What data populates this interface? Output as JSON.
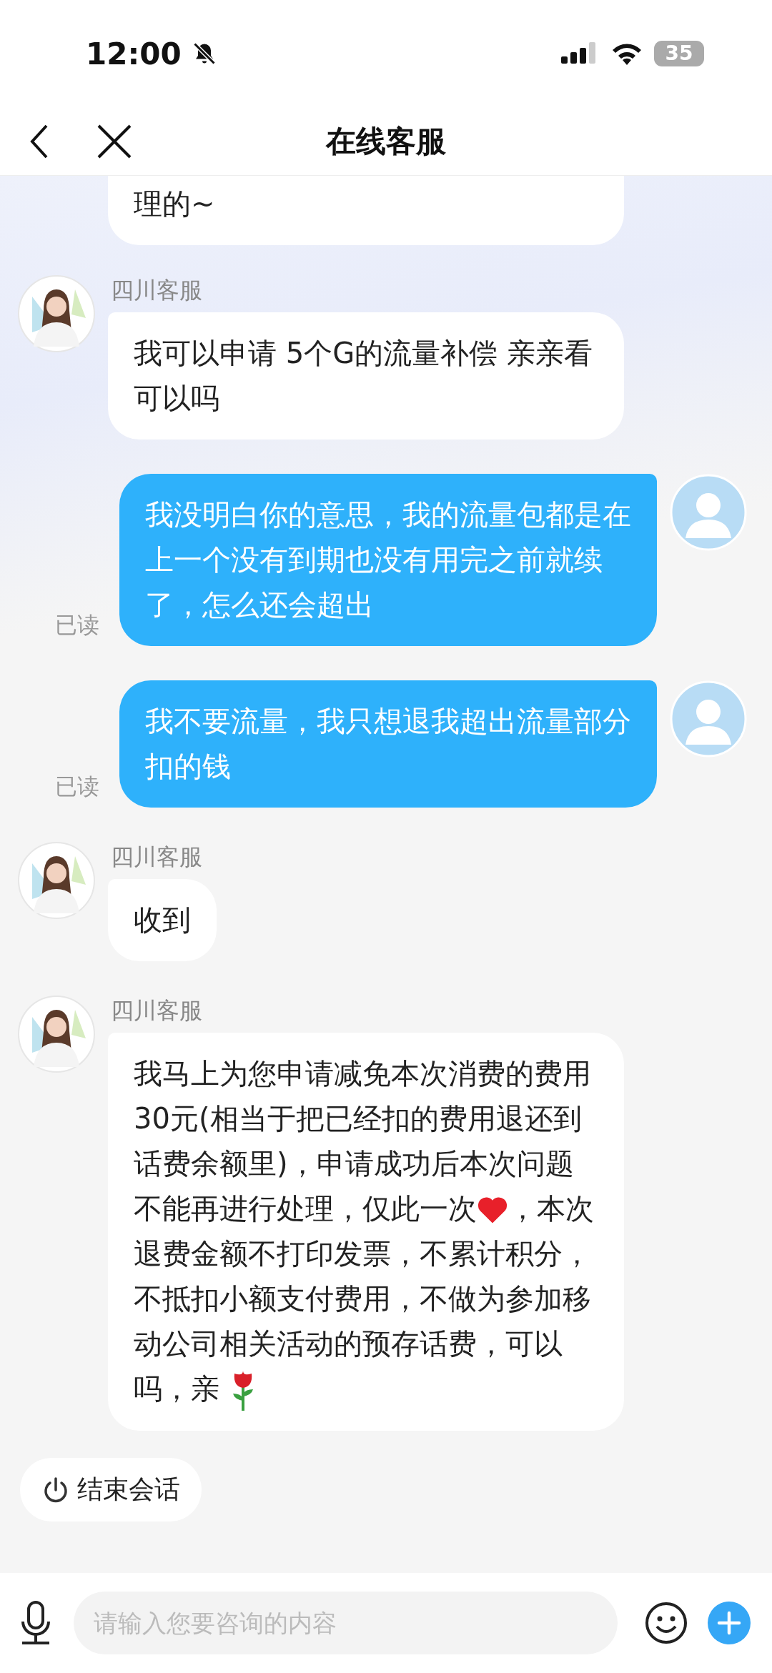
{
  "status_bar": {
    "time": "12:00",
    "battery": "35"
  },
  "header": {
    "title": "在线客服"
  },
  "messages": [
    {
      "kind": "agent",
      "parts": [
        {
          "kind": "text",
          "text": "理的~"
        }
      ]
    },
    {
      "kind": "agent",
      "sender": "四川客服",
      "parts": [
        {
          "kind": "text",
          "text": "我可以申请  5个G的流量补偿 亲亲看可以吗"
        }
      ]
    },
    {
      "kind": "user",
      "read": "已读",
      "parts": [
        {
          "kind": "text",
          "text": "我没明白你的意思，我的流量包都是在上一个没有到期也没有用完之前就续了，怎么还会超出"
        }
      ]
    },
    {
      "kind": "user",
      "read": "已读",
      "parts": [
        {
          "kind": "text",
          "text": "我不要流量，我只想退我超出流量部分扣的钱"
        }
      ]
    },
    {
      "kind": "agent",
      "sender": "四川客服",
      "parts": [
        {
          "kind": "text",
          "text": "收到"
        }
      ]
    },
    {
      "kind": "agent",
      "sender": "四川客服",
      "parts": [
        {
          "kind": "text",
          "text": "我马上为您申请减免本次消费的费用30元(相当于把已经扣的费用退还到话费余额里)，申请成功后本次问题不能再进行处理，仅此一次"
        },
        {
          "kind": "heart"
        },
        {
          "kind": "text",
          "text": "，本次退费金额不打印发票，不累计积分，不抵扣小额支付费用，不做为参加移动公司相关活动的预存话费，可以吗，亲 "
        },
        {
          "kind": "rose"
        }
      ]
    }
  ],
  "end_button": {
    "label": "结束会话"
  },
  "input": {
    "placeholder": "请输入您要咨询的内容"
  }
}
